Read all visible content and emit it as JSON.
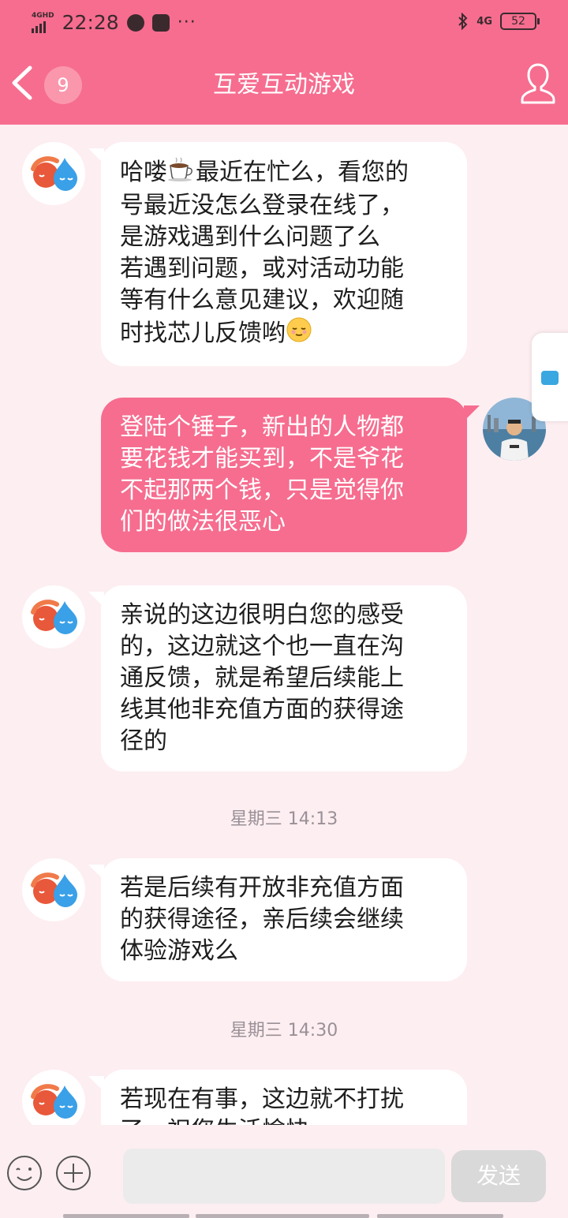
{
  "status_bar": {
    "network": "4GHD",
    "time": "22:28",
    "signal_right": "4G",
    "battery": "52",
    "more": "···"
  },
  "header": {
    "unread_count": "9",
    "title": "互爱互动游戏"
  },
  "messages": [
    {
      "side": "left",
      "lines": [
        "哈喽",
        "最近在忙么，看您的",
        "号最近没怎么登录在线了，",
        "是游戏遇到什么问题了么",
        "若遇到问题，或对活动功能",
        "等有什么意见建议，欢迎随",
        "时找芯儿反馈哟"
      ]
    },
    {
      "side": "right",
      "lines": [
        "登陆个锤子，新出的人物都",
        "要花钱才能买到，不是爷花",
        "不起那两个钱，只是觉得你",
        "们的做法很恶心"
      ]
    },
    {
      "side": "left",
      "lines": [
        "亲说的这边很明白您的感受",
        "的，这边就这个也一直在沟",
        "通反馈，就是希望后续能上",
        "线其他非充值方面的获得途",
        "径的"
      ]
    },
    {
      "side": "left",
      "lines": [
        "若是后续有开放非充值方面",
        "的获得途径，亲后续会继续",
        "体验游戏么"
      ]
    },
    {
      "side": "left",
      "lines": [
        "若现在有事，这边就不打扰",
        "了，祝您生活愉快"
      ]
    }
  ],
  "timestamps": [
    "星期三 14:13",
    "星期三 14:30"
  ],
  "input": {
    "placeholder": "",
    "send_label": "发送"
  },
  "colors": {
    "accent": "#f66d8f",
    "background": "#fdeef1",
    "bubble_other": "#ffffff",
    "send_disabled": "#d9d9d9"
  }
}
